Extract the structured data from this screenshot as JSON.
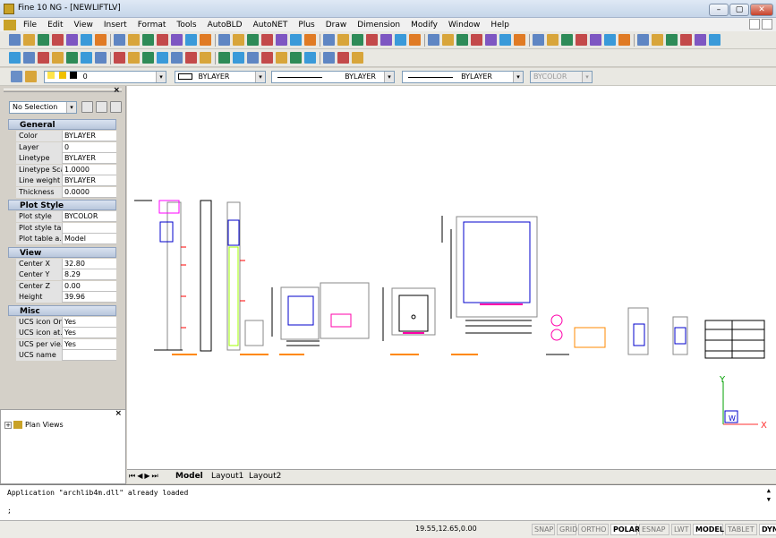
{
  "window": {
    "title": "Fine 10 NG  - [NEWLIFTLV]",
    "min": "–",
    "max": "▢",
    "close": "✕"
  },
  "menu": [
    "File",
    "Edit",
    "View",
    "Insert",
    "Format",
    "Tools",
    "AutoBLD",
    "AutoNET",
    "Plus",
    "Draw",
    "Dimension",
    "Modify",
    "Window",
    "Help"
  ],
  "props_toolbar": {
    "layer": "0",
    "color": "BYLAYER",
    "linetype": "BYLAYER",
    "lineweight": "BYLAYER",
    "plotstyle": "BYCOLOR"
  },
  "properties": {
    "selection": "No Selection",
    "sections": [
      {
        "title": "General",
        "rows": [
          [
            "Color",
            "BYLAYER"
          ],
          [
            "Layer",
            "0"
          ],
          [
            "Linetype",
            "BYLAYER"
          ],
          [
            "Linetype Scale",
            "1.0000"
          ],
          [
            "Line weight",
            "BYLAYER"
          ],
          [
            "Thickness",
            "0.0000"
          ]
        ]
      },
      {
        "title": "Plot Style",
        "rows": [
          [
            "Plot style",
            "BYCOLOR"
          ],
          [
            "Plot style ta...",
            ""
          ],
          [
            "Plot table a...",
            "Model"
          ]
        ]
      },
      {
        "title": "View",
        "rows": [
          [
            "Center X",
            "32.80"
          ],
          [
            "Center Y",
            "8.29"
          ],
          [
            "Center Z",
            "0.00"
          ],
          [
            "Height",
            "39.96"
          ]
        ]
      },
      {
        "title": "Misc",
        "rows": [
          [
            "UCS icon On",
            "Yes"
          ],
          [
            "UCS icon at...",
            "Yes"
          ],
          [
            "UCS per vie...",
            "Yes"
          ],
          [
            "UCS name",
            ""
          ]
        ]
      }
    ]
  },
  "tree": {
    "root": "Plan Views"
  },
  "tabs": [
    "Model",
    "Layout1",
    "Layout2"
  ],
  "command": {
    "history": "Application \"archlib4m.dll\" already loaded",
    "prompt": ";"
  },
  "status": {
    "coords": "19.55,12.65,0.00",
    "toggles": [
      "SNAP",
      "GRID",
      "ORTHO",
      "POLAR",
      "ESNAP",
      "LWT",
      "MODEL",
      "TABLET",
      "DYN"
    ],
    "active": [
      "POLAR",
      "MODEL",
      "DYN"
    ]
  },
  "ucs": {
    "x": "X",
    "y": "Y",
    "w": "W"
  }
}
